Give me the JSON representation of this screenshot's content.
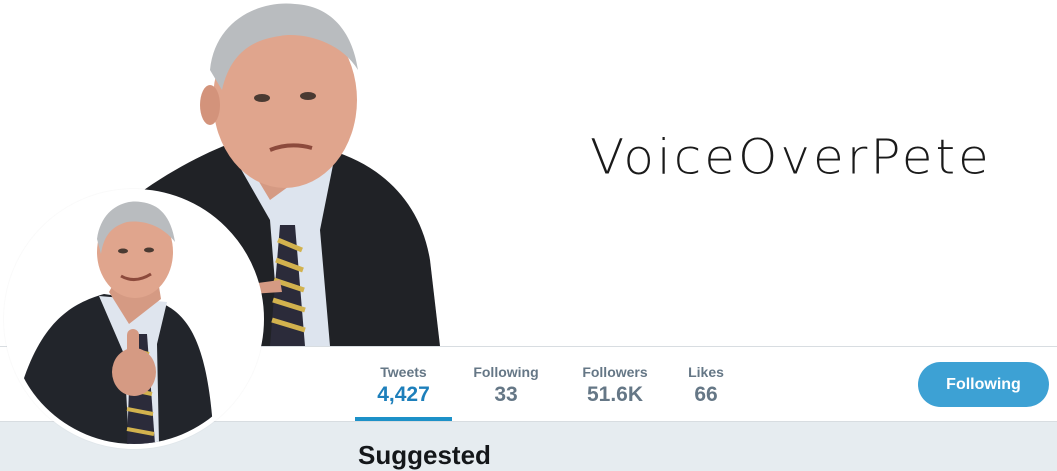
{
  "banner": {
    "title": "VoiceOverPete"
  },
  "nav": {
    "stats": [
      {
        "label": "Tweets",
        "value": "4,427",
        "active": true
      },
      {
        "label": "Following",
        "value": "33",
        "active": false
      },
      {
        "label": "Followers",
        "value": "51.6K",
        "active": false
      },
      {
        "label": "Likes",
        "value": "66",
        "active": false
      }
    ],
    "follow_button_label": "Following"
  },
  "sidebar": {
    "suggested_heading": "Suggested"
  },
  "colors": {
    "accent": "#1d91c8",
    "button": "#3da1d4",
    "muted_text": "#657786",
    "page_bg": "#e6ecf0"
  }
}
